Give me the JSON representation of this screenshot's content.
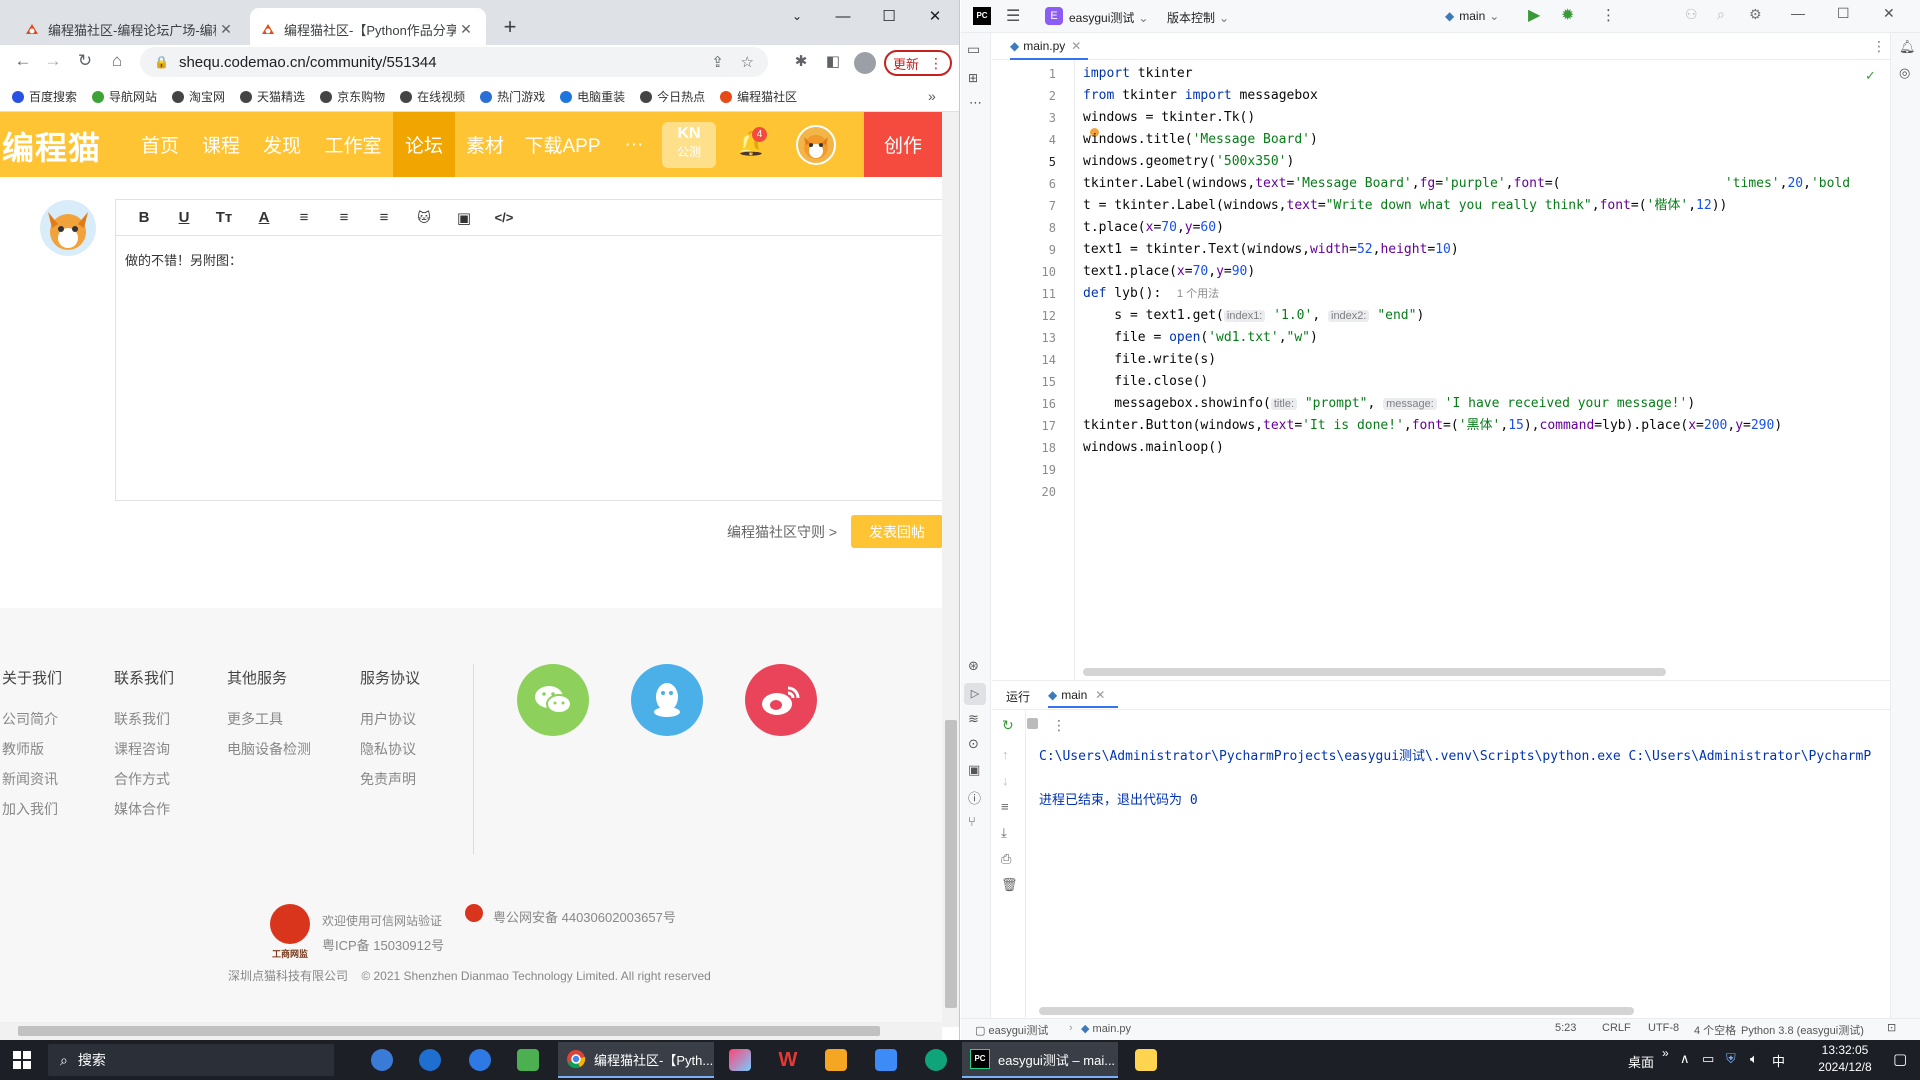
{
  "browser": {
    "tabs": [
      {
        "title": "编程猫社区-编程论坛广场-编程主",
        "active": false
      },
      {
        "title": "编程猫社区-【Python作品分享】",
        "active": true
      }
    ],
    "address": "shequ.codemao.cn/community/551344",
    "update_label": "更新",
    "bookmarks": [
      "百度搜索",
      "导航网站",
      "淘宝网",
      "天猫精选",
      "京东购物",
      "在线视频",
      "热门游戏",
      "电脑重装",
      "今日热点",
      "编程猫社区"
    ],
    "bookmarks_more": "»"
  },
  "site": {
    "logo": "编程猫",
    "nav": [
      "首页",
      "课程",
      "发现",
      "工作室",
      "论坛",
      "素材",
      "下载APP"
    ],
    "nav_more": "···",
    "kn_badge_top": "KN",
    "kn_badge_bottom": "公测",
    "notify_count": "4",
    "create_label": "创作",
    "editor_content": "做的不错！另附图：",
    "editor_tools": [
      "B",
      "U",
      "Tт",
      "A",
      "≡",
      "≡",
      "≡",
      "🐱",
      "▣",
      "</>"
    ],
    "rules_link": "编程猫社区守则 >",
    "reply_button": "发表回帖"
  },
  "footer": {
    "columns": [
      {
        "title": "关于我们",
        "links": [
          "公司简介",
          "教师版",
          "新闻资讯",
          "加入我们"
        ]
      },
      {
        "title": "联系我们",
        "links": [
          "联系我们",
          "课程咨询",
          "合作方式",
          "媒体合作"
        ]
      },
      {
        "title": "其他服务",
        "links": [
          "更多工具",
          "电脑设备检测"
        ]
      },
      {
        "title": "服务协议",
        "links": [
          "用户协议",
          "隐私协议",
          "免责声明"
        ]
      }
    ],
    "trust_text": "欢迎使用可信网站验证",
    "police_text": "粤公网安备 44030602003657号",
    "icp_text": "粤ICP备 15030912号",
    "seal_text": "工商网监",
    "copyright": "深圳点猫科技有限公司    © 2021 Shenzhen Dianmao Technology Limited. All right reserved",
    "social_colors": [
      "#8dd15c",
      "#4cb0e8",
      "#e9445a"
    ]
  },
  "ide": {
    "project": "easygui测试",
    "project_badge": "E",
    "vcs": "版本控制",
    "run_config": "main",
    "file_tab": "main.py",
    "lines": [
      "1",
      "2",
      "3",
      "4",
      "5",
      "6",
      "7",
      "8",
      "9",
      "10",
      "11",
      "12",
      "13",
      "14",
      "15",
      "16",
      "17",
      "18",
      "19",
      "20"
    ],
    "run_label": "运行",
    "run_tab": "main",
    "console_cmd": "C:\\Users\\Administrator\\PycharmProjects\\easygui测试\\.venv\\Scripts\\python.exe C:\\Users\\Administrator\\PycharmP",
    "console_exit": "进程已结束，退出代码为 0",
    "breadcrumb_project": "easygui测试",
    "breadcrumb_file": "main.py",
    "status": [
      "5:23",
      "CRLF",
      "UTF-8",
      "4 个空格",
      "Python 3.8 (easygui测试)"
    ]
  },
  "code": {
    "l1_kw": "import",
    "l1_mod": " tkinter",
    "l2_kw1": "from",
    "l2_mid": " tkinter ",
    "l2_kw2": "import",
    "l2_rest": " messagebox",
    "l3": "windows = tkinter.Tk()",
    "l4_a": "windows.title(",
    "l4_s": "'Message Board'",
    "l4_b": ")",
    "l5_a": "windows.geometry(",
    "l5_s": "'500x350'",
    "l5_b": ")",
    "l6_a": "tkinter.Label(windows,",
    "l6_p1": "text",
    "l6_eq1": "=",
    "l6_s1": "'Message Board'",
    "l6_c1": ",",
    "l6_p2": "fg",
    "l6_eq2": "=",
    "l6_s2": "'purple'",
    "l6_c2": ",",
    "l6_p3": "font",
    "l6_eq3": "=(",
    "l6_gap": "                     ",
    "l6_s3": "'times'",
    "l6_c3": ",",
    "l6_n": "20",
    "l6_c4": ",",
    "l6_s4": "'bold",
    "l7_a": "t = tkinter.Label(windows,",
    "l7_p1": "text",
    "l7_eq1": "=",
    "l7_s1": "\"Write down what you really think\"",
    "l7_c1": ",",
    "l7_p2": "font",
    "l7_eq2": "=(",
    "l7_s2": "'楷体'",
    "l7_c2": ",",
    "l7_n": "12",
    "l7_b": "))",
    "l8_a": "t.place(",
    "l8_p1": "x",
    "l8_eq1": "=",
    "l8_n1": "70",
    "l8_c": ",",
    "l8_p2": "y",
    "l8_eq2": "=",
    "l8_n2": "60",
    "l8_b": ")",
    "l9_a": "text1 = tkinter.Text(windows,",
    "l9_p1": "width",
    "l9_eq1": "=",
    "l9_n1": "52",
    "l9_c": ",",
    "l9_p2": "height",
    "l9_eq2": "=",
    "l9_n2": "10",
    "l9_b": ")",
    "l10_a": "text1.place(",
    "l10_p1": "x",
    "l10_eq1": "=",
    "l10_n1": "70",
    "l10_c": ",",
    "l10_p2": "y",
    "l10_eq2": "=",
    "l10_n2": "90",
    "l10_b": ")",
    "l11_kw": "def",
    "l11_a": " lyb():",
    "l11_hint": "1 个用法",
    "l12_a": "    s = text1.get(",
    "l12_h1": "index1:",
    "l12_s1": "'1.0'",
    "l12_c": ", ",
    "l12_h2": "index2:",
    "l12_s2": "\"end\"",
    "l12_b": ")",
    "l13_a": "    file = ",
    "l13_fn": "open",
    "l13_b": "(",
    "l13_s1": "'wd1.txt'",
    "l13_c": ",",
    "l13_s2": "\"w\"",
    "l13_e": ")",
    "l14": "    file.write(s)",
    "l15": "    file.close()",
    "l16_a": "    messagebox.showinfo(",
    "l16_h1": "title:",
    "l16_s1": "\"prompt\"",
    "l16_c": ", ",
    "l16_h2": "message:",
    "l16_s2": "'I have received your message!'",
    "l16_b": ")",
    "l17_a": "tkinter.Button(windows,",
    "l17_p1": "text",
    "l17_eq1": "=",
    "l17_s1": "'It is done!'",
    "l17_c1": ",",
    "l17_p2": "font",
    "l17_eq2": "=(",
    "l17_s2": "'黑体'",
    "l17_c2": ",",
    "l17_n1": "15",
    "l17_c3": "),",
    "l17_p3": "command",
    "l17_eq3": "=lyb).place(",
    "l17_p4": "x",
    "l17_eq4": "=",
    "l17_n2": "200",
    "l17_c4": ",",
    "l17_p5": "y",
    "l17_eq5": "=",
    "l17_n3": "290",
    "l17_b": ")",
    "l18": "windows.mainloop()"
  },
  "taskbar": {
    "search": "搜索",
    "chrome_label": "编程猫社区-【Pyth...",
    "pycharm_label": "easygui测试 – mai...",
    "desktop_label": "桌面",
    "ime": "中",
    "time": "13:32:05",
    "date": "2024/12/8",
    "chevron": "»"
  }
}
